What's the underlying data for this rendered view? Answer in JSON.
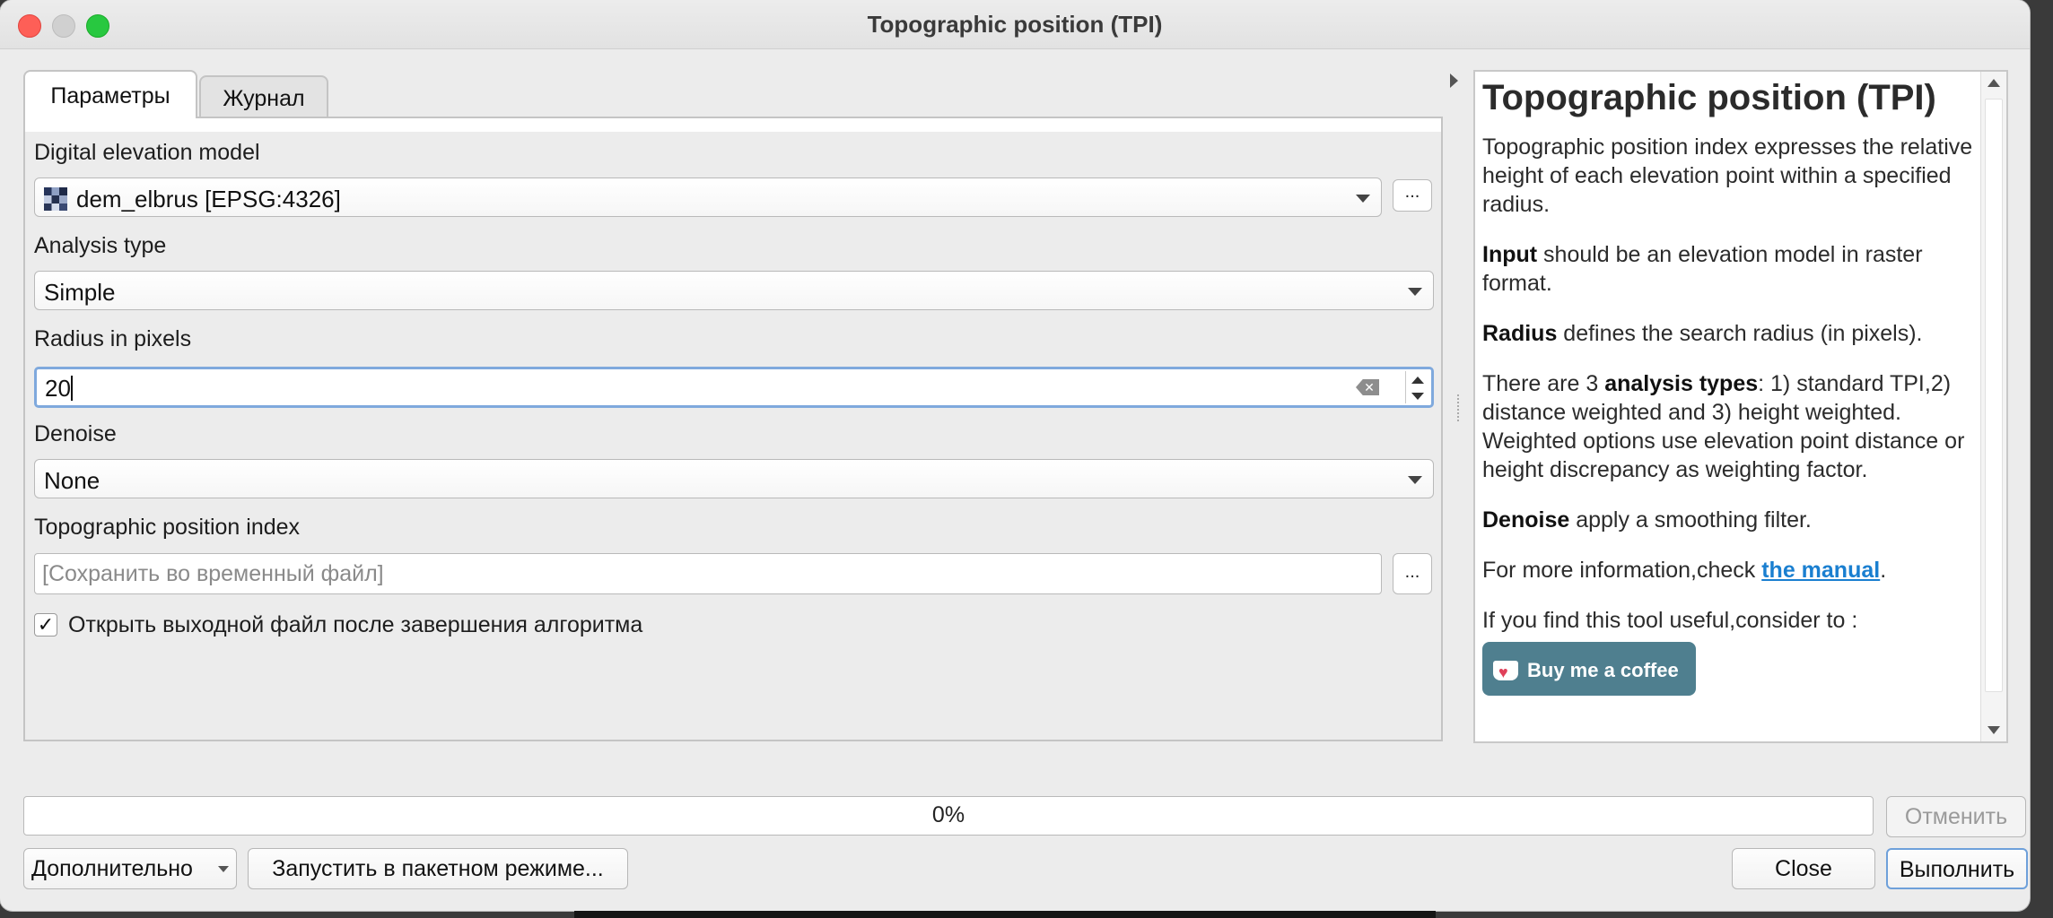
{
  "window": {
    "title": "Topographic position (TPI)"
  },
  "tabs": [
    {
      "label": "Параметры",
      "active": true
    },
    {
      "label": "Журнал",
      "active": false
    }
  ],
  "params": {
    "dem": {
      "label": "Digital elevation model",
      "value": "dem_elbrus [EPSG:4326]",
      "button": "..."
    },
    "analysis": {
      "label": "Analysis type",
      "value": "Simple"
    },
    "radius": {
      "label": "Radius in pixels",
      "value": "20"
    },
    "denoise": {
      "label": "Denoise",
      "value": "None"
    },
    "output": {
      "label": "Topographic position index",
      "placeholder": "[Сохранить во временный файл]",
      "button": "..."
    },
    "open_output": {
      "label": "Открыть выходной файл после завершения алгоритма",
      "checked": true,
      "mark": "✓"
    }
  },
  "help": {
    "title": "Topographic position (TPI)",
    "p1": "Topographic position index expresses the relative height of each elevation point within a specified radius.",
    "p2_bold": "Input",
    "p2_rest": " should be an elevation model in raster format.",
    "p3_bold": "Radius",
    "p3_rest": " defines the search radius (in pixels).",
    "p4_pre": "There are 3 ",
    "p4_bold": "analysis types",
    "p4_rest": ": 1) standard TPI,2) distance weighted and 3) height weighted. Weighted options use elevation point distance or height discrepancy as weighting factor.",
    "p5_bold": "Denoise",
    "p5_rest": " apply a smoothing filter.",
    "p6_pre": "For more information,check ",
    "p6_link": "the manual",
    "p6_post": ".",
    "p7": "If you find this tool useful,consider to :",
    "coffee": "Buy me a coffee"
  },
  "progress": {
    "text": "0%",
    "value": 0
  },
  "buttons": {
    "cancel": "Отменить",
    "advanced": "Дополнительно",
    "batch": "Запустить в пакетном режиме...",
    "close": "Close",
    "run": "Выполнить"
  },
  "icons": [
    "close-traffic-icon",
    "minimize-traffic-icon",
    "maximize-traffic-icon",
    "raster-layer-icon",
    "chevron-down-icon",
    "clear-text-icon",
    "spin-up-icon",
    "spin-down-icon",
    "checkmark-icon",
    "collapse-arrow-icon",
    "coffee-cup-icon"
  ],
  "colors": {
    "focus_border": "#7fa9dd",
    "link": "#1a7fd0",
    "coffee_button": "#4f7f8f",
    "close_light": "#fe5f57",
    "max_light": "#28c840"
  }
}
